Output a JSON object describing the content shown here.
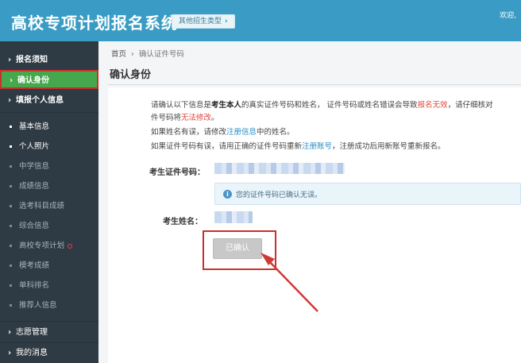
{
  "header": {
    "title": "高校专项计划报名系统",
    "type_button": "其他招生类型",
    "welcome": "欢迎,"
  },
  "sidebar": {
    "items": [
      {
        "label": "报名须知"
      },
      {
        "label": "确认身份"
      },
      {
        "label": "填报个人信息"
      }
    ],
    "sub_items": [
      {
        "label": "基本信息"
      },
      {
        "label": "个人照片"
      },
      {
        "label": "中学信息"
      },
      {
        "label": "成绩信息"
      },
      {
        "label": "选考科目成绩"
      },
      {
        "label": "综合信息"
      },
      {
        "label": "高校专项计划"
      },
      {
        "label": "模考成绩"
      },
      {
        "label": "单科排名"
      },
      {
        "label": "推荐人信息"
      }
    ],
    "bottom_items": [
      {
        "label": "志愿管理"
      },
      {
        "label": "我的消息"
      }
    ]
  },
  "breadcrumb": {
    "home": "首页",
    "current": "确认证件号码"
  },
  "page": {
    "title": "确认身份",
    "notice": {
      "l1a": "请确认以下信息是",
      "l1b": "考生本人",
      "l1c": "的真实证件号码和姓名，  证件号码或姓名错误会导致",
      "l1d": "报名无效",
      "l1e": "，请仔细核对",
      "l2a": "件号码将",
      "l2b": "无法修改",
      "l2c": "。",
      "l3a": "如果姓名有误，请修改",
      "l3b": "注册信息",
      "l3c": "中的姓名。",
      "l4a": "如果证件号码有误，请用正确的证件号码重新",
      "l4b": "注册账号",
      "l4c": "，注册成功后用新账号重新报名。"
    },
    "id_label": "考生证件号码：",
    "tip": "您的证件号码已确认无误。",
    "name_label": "考生姓名：",
    "confirm_button": "已确认"
  },
  "colors": {
    "header": "#3a9cc4",
    "sidebar": "#2f3b44",
    "active": "#46a84c",
    "highlight": "#c9302c"
  }
}
